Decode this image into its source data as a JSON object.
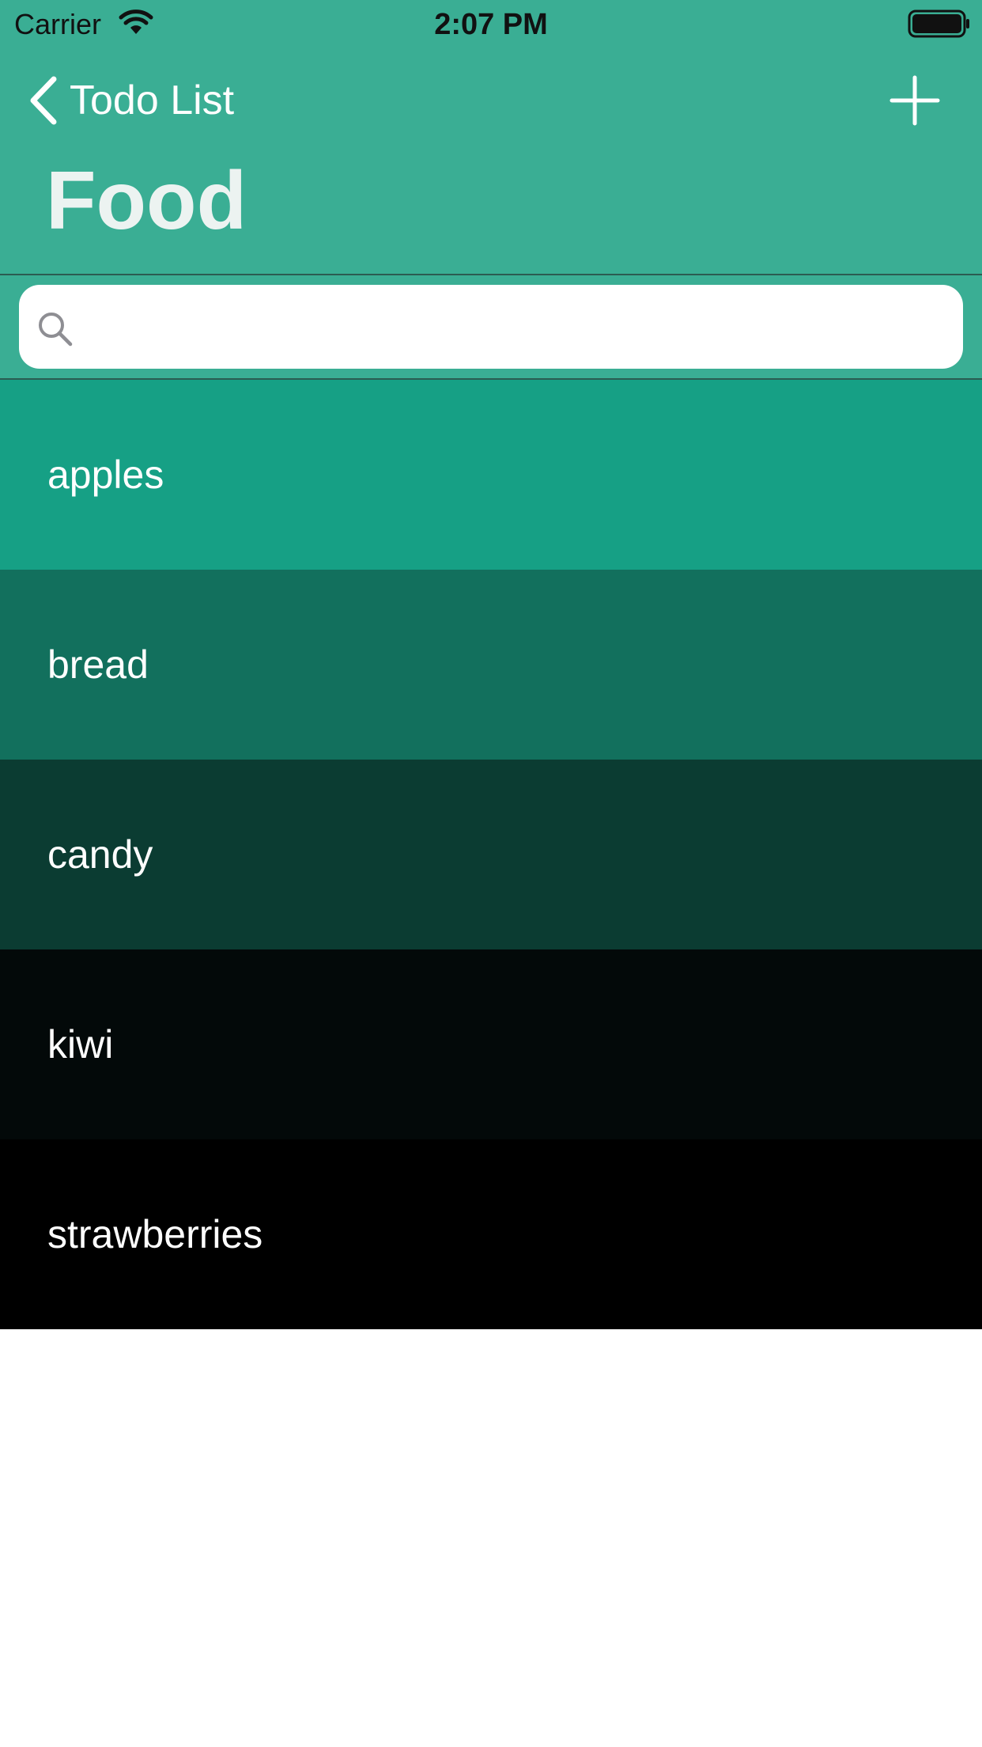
{
  "status_bar": {
    "carrier": "Carrier",
    "time": "2:07 PM"
  },
  "nav": {
    "back_label": "Todo List",
    "title": "Food",
    "add_icon": "plus-icon",
    "back_icon": "chevron-left-icon"
  },
  "search": {
    "value": "",
    "placeholder": "",
    "icon": "magnifying-glass-icon"
  },
  "items": [
    {
      "label": "apples",
      "color": "#16a085"
    },
    {
      "label": "bread",
      "color": "#12705d"
    },
    {
      "label": "candy",
      "color": "#0b3c32"
    },
    {
      "label": "kiwi",
      "color": "#030909"
    },
    {
      "label": "strawberries",
      "color": "#000000"
    }
  ],
  "colors": {
    "nav_background": "#3aae94",
    "title_text": "#ecf3f1",
    "page_background": "#ffffff"
  }
}
